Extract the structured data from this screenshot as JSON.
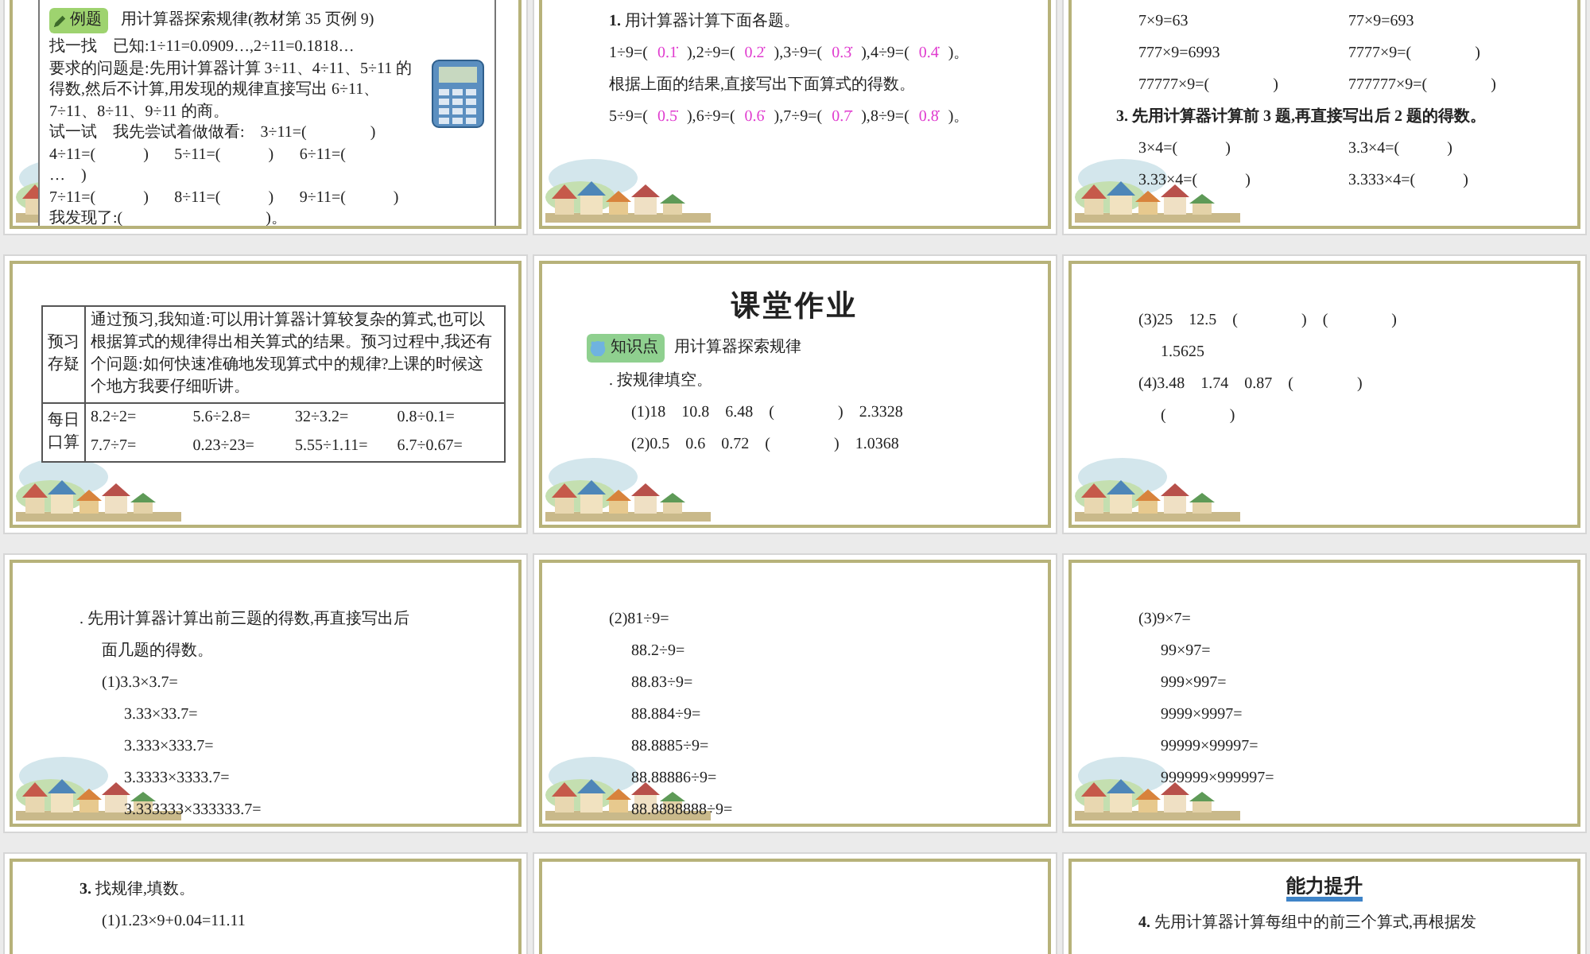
{
  "slides": [
    {
      "kind": "example",
      "blocks": [
        {
          "kind": "tag",
          "tag": "例题",
          "text": "用计算器探索规律(教材第 35 页例 9)"
        },
        {
          "kind": "line",
          "text": "找一找　已知:1÷11=0.0909…,2÷11=0.1818…"
        },
        {
          "kind": "line",
          "text": "要求的问题是:先用计算器计算 3÷11、4÷11、5÷11 的得数,然后不计算,用发现的规律直接写出 6÷11、7÷11、8÷11、9÷11 的商。"
        },
        {
          "kind": "line",
          "text": "试一试　我先尝试着做做看:　3÷11=(　　　　)"
        },
        {
          "kind": "triple",
          "cells": [
            "4÷11=(　　　)",
            "5÷11=(　　　)",
            "6÷11=("
          ]
        },
        {
          "kind": "line",
          "text": "…　)"
        },
        {
          "kind": "triple",
          "cells": [
            "7÷11=(　　　)",
            "8÷11=(　　　)",
            "9÷11=(　　　)"
          ]
        },
        {
          "kind": "line",
          "text": "我发现了:(　　　　　　　　　)。"
        }
      ]
    },
    {
      "kind": "plain",
      "blocks": [
        {
          "kind": "line",
          "text": "**1.** 用计算器计算下面各题。"
        },
        {
          "kind": "answers",
          "items": [
            {
              "before": "1÷9=(",
              "answer": "0.1̇",
              "after": "),"
            },
            {
              "before": "2÷9=(",
              "answer": "0.2̇",
              "after": "),"
            },
            {
              "before": "3÷9=(",
              "answer": "0.3̇",
              "after": "),"
            },
            {
              "before": "4÷9=(",
              "answer": "0.4̇",
              "after": ")。"
            }
          ]
        },
        {
          "kind": "line",
          "text": "根据上面的结果,直接写出下面算式的得数。"
        },
        {
          "kind": "answers",
          "items": [
            {
              "before": "5÷9=(",
              "answer": "0.5̇",
              "after": "),"
            },
            {
              "before": "6÷9=(",
              "answer": "0.6̇",
              "after": "),"
            },
            {
              "before": "7÷9=(",
              "answer": "0.7̇",
              "after": "),"
            },
            {
              "before": "8÷9=(",
              "answer": "0.8̇",
              "after": ")。"
            }
          ]
        }
      ]
    },
    {
      "kind": "plain",
      "blocks": [
        {
          "kind": "pair",
          "cells": [
            "7×9=63",
            "77×9=693"
          ]
        },
        {
          "kind": "pair",
          "cells": [
            "777×9=6993",
            "7777×9=(　　　　)"
          ]
        },
        {
          "kind": "pair",
          "cells": [
            "77777×9=(　　　　)",
            "777777×9=(　　　　)"
          ]
        },
        {
          "kind": "task",
          "text": "3. 先用计算器计算前 3 题,再直接写出后 2 题的得数。"
        },
        {
          "kind": "pair",
          "cells": [
            "3×4=(　　　)",
            "3.3×4=(　　　)"
          ]
        },
        {
          "kind": "pair",
          "cells": [
            "3.33×4=(　　　)",
            "3.333×4=(　　　)"
          ]
        }
      ]
    },
    {
      "kind": "plain",
      "blocks": [
        {
          "kind": "table",
          "rows": [
            {
              "head": "预习存疑",
              "text": "通过预习,我知道:可以用计算器计算较复杂的算式,也可以根据算式的规律得出相关算式的结果。预习过程中,我还有个问题:如何快速准确地发现算式中的规律?上课的时候这个地方我要仔细听讲。"
            },
            {
              "head": "每日口算",
              "cells": [
                "8.2÷2=",
                "5.6÷2.8=",
                "32÷3.2=",
                "0.8÷0.1=",
                "7.7÷7=",
                "0.23÷23=",
                "5.55÷1.11=",
                "6.7÷0.67="
              ]
            }
          ]
        }
      ]
    },
    {
      "kind": "plain",
      "blocks": [
        {
          "kind": "title",
          "text": "课堂作业"
        },
        {
          "kind": "topic",
          "tag": "知识点",
          "text": "用计算器探索规律"
        },
        {
          "kind": "line",
          "text": ". 按规律填空。"
        },
        {
          "kind": "subline",
          "text": "(1)18　10.8　6.48　(　　　　)　2.3328"
        },
        {
          "kind": "subline",
          "text": "(2)0.5　0.6　0.72　(　　　　)　1.0368"
        }
      ]
    },
    {
      "kind": "plain",
      "blocks": [
        {
          "kind": "line",
          "text": "(3)25　12.5　(　　　　)　(　　　　)"
        },
        {
          "kind": "subline",
          "text": "1.5625"
        },
        {
          "kind": "line",
          "text": "(4)3.48　1.74　0.87　(　　　　)"
        },
        {
          "kind": "subline",
          "text": "(　　　　)"
        }
      ]
    },
    {
      "kind": "plain",
      "blocks": [
        {
          "kind": "line",
          "text": ". 先用计算器计算出前三题的得数,再直接写出后"
        },
        {
          "kind": "subline",
          "text": "面几题的得数。"
        },
        {
          "kind": "subline",
          "text": "(1)3.3×3.7="
        },
        {
          "kind": "subline2",
          "text": "3.33×33.7="
        },
        {
          "kind": "subline2",
          "text": "3.333×333.7="
        },
        {
          "kind": "subline2",
          "text": "3.3333×3333.7="
        },
        {
          "kind": "subline2",
          "text": "3.333333×333333.7="
        }
      ]
    },
    {
      "kind": "plain",
      "blocks": [
        {
          "kind": "line",
          "text": "(2)81÷9="
        },
        {
          "kind": "subline",
          "text": "88.2÷9="
        },
        {
          "kind": "subline",
          "text": "88.83÷9="
        },
        {
          "kind": "subline",
          "text": "88.884÷9="
        },
        {
          "kind": "subline",
          "text": "88.8885÷9="
        },
        {
          "kind": "subline",
          "text": "88.88886÷9="
        },
        {
          "kind": "subline",
          "text": "88.8888888÷9="
        }
      ]
    },
    {
      "kind": "plain",
      "blocks": [
        {
          "kind": "line",
          "text": "(3)9×7="
        },
        {
          "kind": "subline",
          "text": "99×97="
        },
        {
          "kind": "subline",
          "text": "999×997="
        },
        {
          "kind": "subline",
          "text": "9999×9997="
        },
        {
          "kind": "subline",
          "text": "99999×99997="
        },
        {
          "kind": "subline",
          "text": "999999×999997="
        }
      ]
    },
    {
      "kind": "plain",
      "blocks": [
        {
          "kind": "line",
          "text": "**3.** 找规律,填数。"
        },
        {
          "kind": "subline",
          "text": "(1)1.23×9+0.04=11.11"
        }
      ]
    },
    {
      "kind": "plain"
    },
    {
      "kind": "plain",
      "blocks": [
        {
          "kind": "section",
          "text": "能力提升"
        },
        {
          "kind": "line",
          "text": "**4.** 先用计算器计算每组中的前三个算式,再根据发"
        }
      ]
    }
  ]
}
